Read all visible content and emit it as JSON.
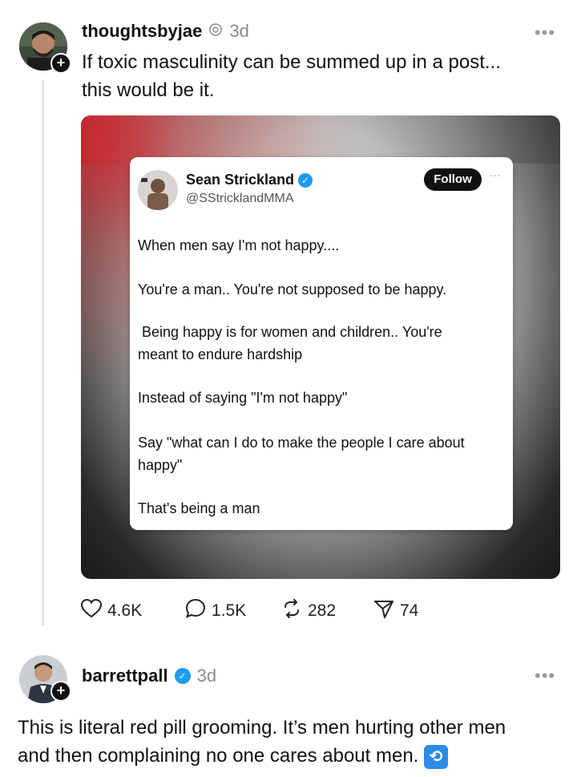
{
  "post1": {
    "username": "thoughtsbyjae",
    "time": "3d",
    "text_line1": "If toxic masculinity can be summed up in a post...",
    "text_line2": "this would be it.",
    "more": "•••",
    "embedded": {
      "name": "Sean Strickland",
      "handle": "@SStricklandMMA",
      "follow_label": "Follow",
      "more": "···",
      "paragraphs": [
        "When men say I'm not happy....",
        "You're a man.. You're not supposed to be happy.",
        " Being happy is for women and children.. You're",
        "meant to endure hardship",
        "Instead of saying \"I'm not happy\"",
        "Say \"what can I do to make the people I care about",
        "happy\"",
        "That's being a man"
      ]
    },
    "stats": {
      "likes": "4.6K",
      "replies": "1.5K",
      "reposts": "282",
      "shares": "74"
    }
  },
  "post2": {
    "username": "barrettpall",
    "time": "3d",
    "more": "•••",
    "text_line1": "This is literal red pill grooming. It’s men hurting other men",
    "text_line2": "and then complaining no one cares about men."
  },
  "colors": {
    "verified": "#1d9bf0",
    "text": "#111111",
    "muted": "#8a8a8a"
  },
  "icons": [
    "heart-icon",
    "comment-icon",
    "repost-icon",
    "share-icon",
    "verified-icon",
    "plus-icon",
    "threads-icon"
  ]
}
